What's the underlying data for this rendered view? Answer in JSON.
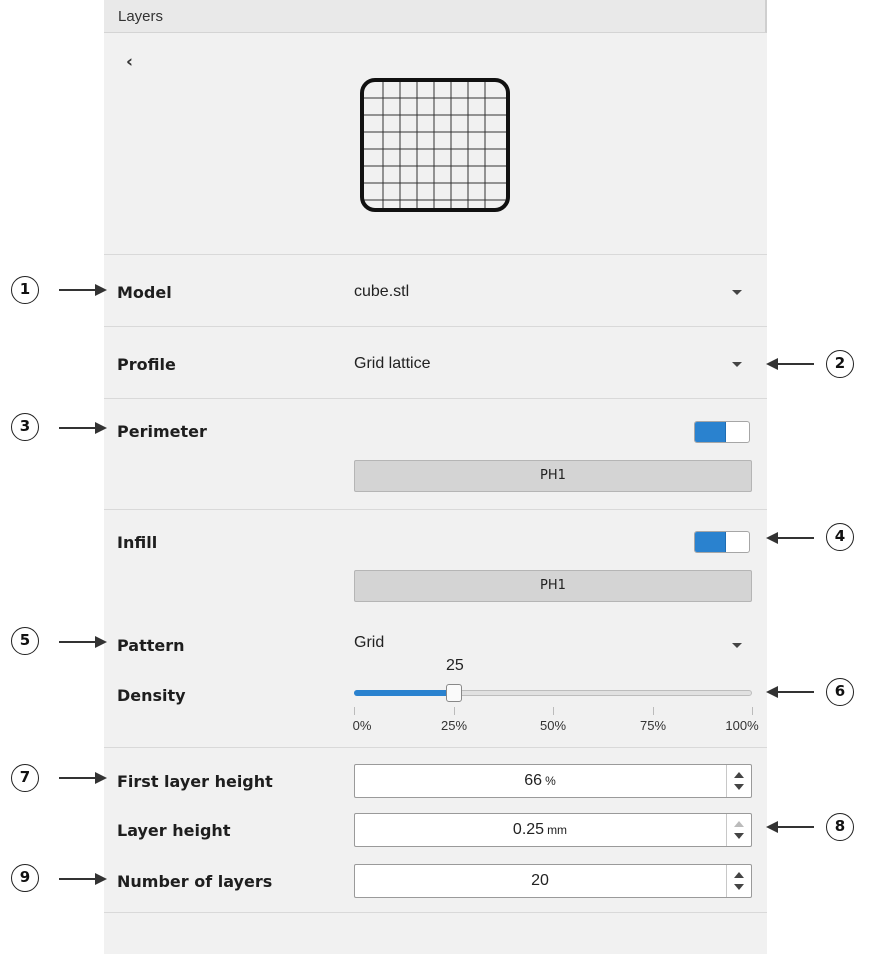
{
  "header": {
    "title": "Layers"
  },
  "back_icon": "chevron-left-icon",
  "back_glyph": "‹",
  "preview_icon": "grid-lattice-preview",
  "model": {
    "label": "Model",
    "value": "cube.stl"
  },
  "profile": {
    "label": "Profile",
    "value": "Grid lattice"
  },
  "perimeter": {
    "label": "Perimeter",
    "enabled": true,
    "button_label": "PH1"
  },
  "infill": {
    "label": "Infill",
    "enabled": true,
    "button_label": "PH1",
    "pattern": {
      "label": "Pattern",
      "value": "Grid"
    },
    "density": {
      "label": "Density",
      "value": 25,
      "value_text": "25",
      "min": 0,
      "max": 100,
      "ticks": [
        "0%",
        "25%",
        "50%",
        "75%",
        "100%"
      ]
    }
  },
  "first_layer_height": {
    "label": "First layer height",
    "value": "66",
    "unit": "%"
  },
  "layer_height": {
    "label": "Layer height",
    "value": "0.25",
    "unit": "mm"
  },
  "number_of_layers": {
    "label": "Number of layers",
    "value": "20",
    "unit": ""
  },
  "callouts": [
    "1",
    "2",
    "3",
    "4",
    "5",
    "6",
    "7",
    "8",
    "9"
  ],
  "colors": {
    "accent": "#2a82cf",
    "panel": "#f1f1f1",
    "button": "#d4d4d4"
  }
}
